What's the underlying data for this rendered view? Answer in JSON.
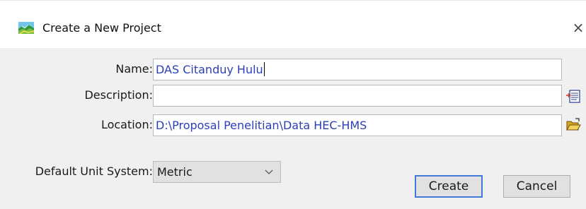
{
  "window": {
    "title": "Create a New Project",
    "close_glyph": "×",
    "app_icon": "landscape-icon"
  },
  "form": {
    "name": {
      "label": "Name:",
      "value": "DAS Citanduy Hulu"
    },
    "description": {
      "label": "Description:",
      "value": "",
      "button_icon": "text-editor-icon"
    },
    "location": {
      "label": "Location:",
      "value": "D:\\Proposal Penelitian\\Data HEC-HMS",
      "button_icon": "open-folder-icon"
    },
    "unit_system": {
      "label": "Default Unit System:",
      "value": "Metric"
    }
  },
  "buttons": {
    "create": "Create",
    "cancel": "Cancel"
  },
  "colors": {
    "field_text": "#2a3fb8",
    "default_button_border": "#3d7bd6",
    "dialog_bg": "#f0f0f0"
  }
}
